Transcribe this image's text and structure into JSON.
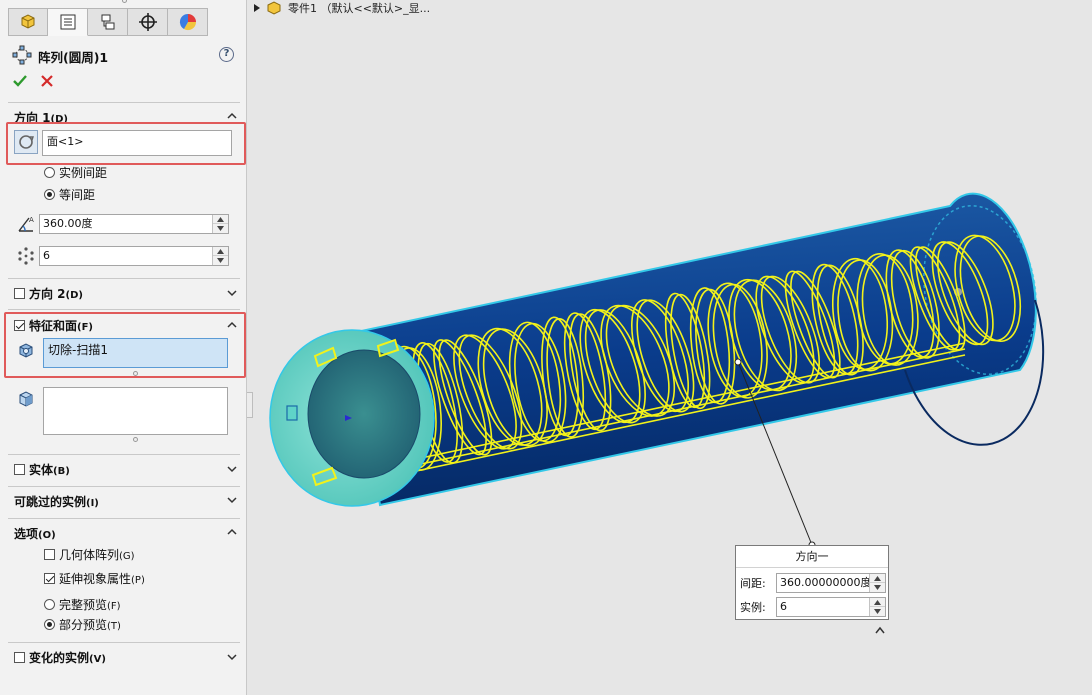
{
  "breadcrumb": {
    "text": "零件1 （默认<<默认>_显..."
  },
  "feature": {
    "title": "阵列(圆周)1",
    "help": "?"
  },
  "direction1": {
    "title": "方向 1",
    "shortcut": "(D)",
    "selection": "面<1>",
    "spacing_options": [
      "实例间距",
      "等间距"
    ],
    "selected_spacing": "等间距",
    "angle": "360.00度",
    "count": "6"
  },
  "direction2": {
    "title": "方向 2",
    "shortcut": "(D)",
    "checked": false
  },
  "features_faces": {
    "title": "特征和面",
    "shortcut": "(F)",
    "checked": true,
    "features_selection": "切除-扫描1"
  },
  "bodies": {
    "title": "实体",
    "shortcut": "(B)"
  },
  "skip_instances": {
    "title": "可跳过的实例",
    "shortcut": "(I)"
  },
  "options": {
    "title": "选项",
    "shortcut": "(O)",
    "geometry_pattern": {
      "label": "几何体阵列",
      "shortcut": "(G)",
      "checked": false
    },
    "propagate_visual": {
      "label": "延伸视象属性",
      "shortcut": "(P)",
      "checked": true
    },
    "full_preview": {
      "label": "完整预览",
      "shortcut": "(F)"
    },
    "partial_preview": {
      "label": "部分预览",
      "shortcut": "(T)"
    }
  },
  "varied_instances": {
    "title": "变化的实例",
    "shortcut": "(V)"
  },
  "callout": {
    "title": "方向一",
    "spacing_label": "间距:",
    "spacing_value": "360.00000000度",
    "instances_label": "实例:",
    "instances_value": "6"
  },
  "colors": {
    "accent_red": "#e05a5a",
    "tube_blue": "#0a3c8c",
    "helix_yellow": "#f2f21a",
    "face_cyan": "#5fd3c8"
  }
}
